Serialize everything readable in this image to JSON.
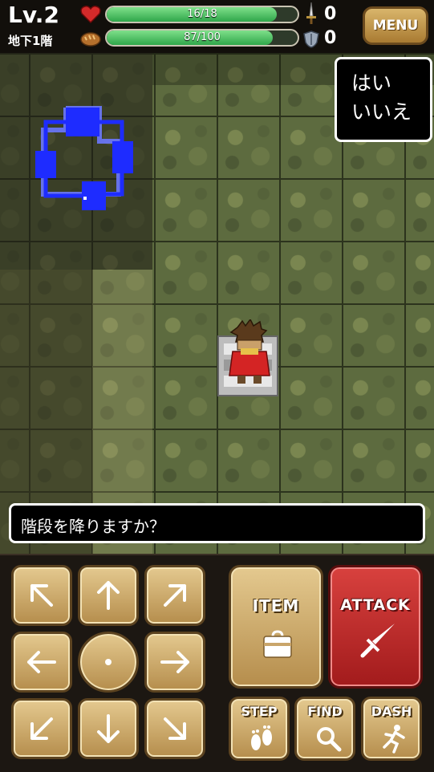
{
  "hud": {
    "level": "Lv.2",
    "floor": "地下1階",
    "hp": {
      "text": "16/18",
      "current": 16,
      "max": 18
    },
    "food": {
      "text": "87/100",
      "current": 87,
      "max": 100
    },
    "attack_value": "0",
    "defense_value": "0",
    "menu_label": "MENU"
  },
  "dialog": {
    "choices": [
      "はい",
      "いいえ"
    ],
    "message": "階段を降りますか？"
  },
  "controls": {
    "item_label": "ITEM",
    "attack_label": "ATTACK",
    "step_label": "STEP",
    "find_label": "FIND",
    "dash_label": "DASH"
  },
  "colors": {
    "hp_bar": "#2fa64a",
    "attack_button": "#c0302f",
    "button_gold": "#d2b06f",
    "minimap": "#1e2cff"
  }
}
